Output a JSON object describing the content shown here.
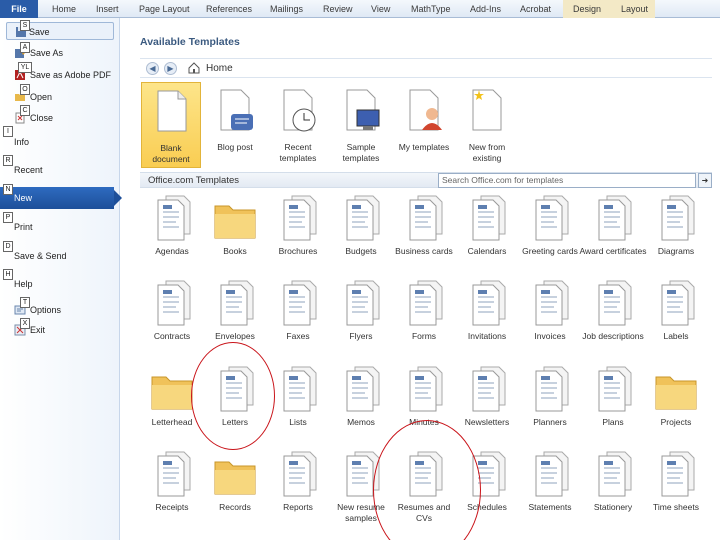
{
  "ribbon": {
    "tabs": [
      "File",
      "Home",
      "Insert",
      "Page Layout",
      "References",
      "Mailings",
      "Review",
      "View",
      "MathType",
      "Add-Ins",
      "Acrobat",
      "Design",
      "Layout"
    ]
  },
  "backstage": {
    "commands": [
      {
        "label": "Save",
        "keytip": "S"
      },
      {
        "label": "Save As",
        "keytip": "A"
      },
      {
        "label": "Save as Adobe PDF",
        "keytip": "YL"
      },
      {
        "label": "Open",
        "keytip": "O"
      },
      {
        "label": "Close",
        "keytip": "C"
      }
    ],
    "categories": [
      {
        "label": "Info",
        "keytip": "I"
      },
      {
        "label": "Recent",
        "keytip": "R"
      },
      {
        "label": "New",
        "keytip": "N"
      },
      {
        "label": "Print",
        "keytip": "P"
      },
      {
        "label": "Save & Send",
        "keytip": "D"
      },
      {
        "label": "Help",
        "keytip": "H"
      }
    ],
    "footer": [
      {
        "label": "Options",
        "keytip": "T"
      },
      {
        "label": "Exit",
        "keytip": "X"
      }
    ]
  },
  "main": {
    "heading": "Available Templates",
    "nav": {
      "back": "◀",
      "forward": "▶",
      "breadcrumb": "Home"
    },
    "top_templates": [
      {
        "label": "Blank document",
        "icon": "blank-document-icon"
      },
      {
        "label": "Blog post",
        "icon": "blog-post-icon"
      },
      {
        "label": "Recent templates",
        "icon": "recent-templates-icon"
      },
      {
        "label": "Sample templates",
        "icon": "sample-templates-icon"
      },
      {
        "label": "My templates",
        "icon": "my-templates-icon"
      },
      {
        "label": "New from existing",
        "icon": "new-from-existing-icon"
      }
    ],
    "office_section": {
      "title": "Office.com Templates",
      "search_placeholder": "Search Office.com for templates",
      "search_button": "➜"
    },
    "office_templates": [
      [
        "Agendas",
        "Books",
        "Brochures",
        "Budgets",
        "Business cards",
        "Calendars",
        "Greeting cards",
        "Award certificates",
        "Diagrams"
      ],
      [
        "Contracts",
        "Envelopes",
        "Faxes",
        "Flyers",
        "Forms",
        "Invitations",
        "Invoices",
        "Job descriptions",
        "Labels"
      ],
      [
        "Letterhead",
        "Letters",
        "Lists",
        "Memos",
        "Minutes",
        "Newsletters",
        "Planners",
        "Plans",
        "Projects"
      ],
      [
        "Receipts",
        "Records",
        "Reports",
        "New resume samples",
        "Resumes and CVs",
        "Schedules",
        "Statements",
        "Stationery",
        "Time sheets"
      ]
    ]
  },
  "colors": {
    "file_tab": "#2a5ca8",
    "selected_tile": "#f9cd52",
    "annotation": "#c9141a"
  }
}
